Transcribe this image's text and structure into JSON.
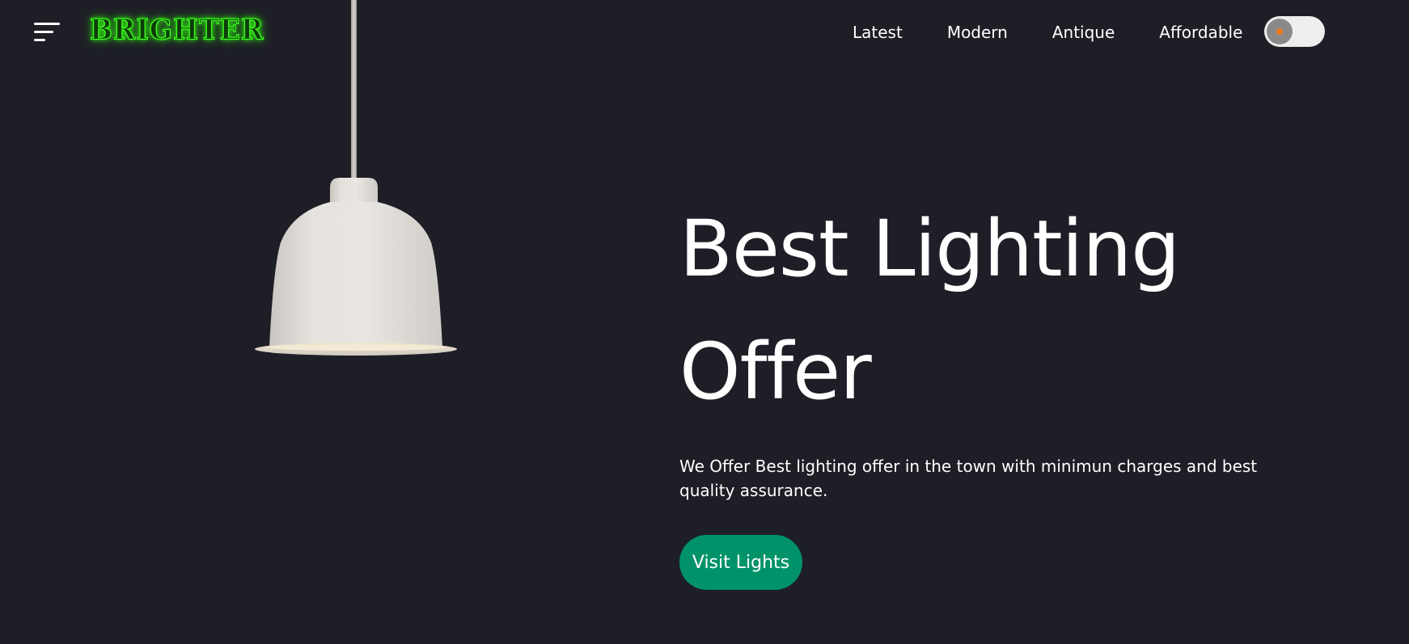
{
  "header": {
    "menu_icon": "hamburger-menu-icon",
    "logo_text": "BRIGHTER",
    "logo_color": "#3bff1c",
    "nav": [
      {
        "label": "Latest"
      },
      {
        "label": "Modern"
      },
      {
        "label": "Antique"
      },
      {
        "label": "Affordable"
      }
    ],
    "theme_toggle": {
      "state": "off",
      "knob_color": "#8a8a8a",
      "dot_color": "#f07a18"
    }
  },
  "hero": {
    "image": "pendant-lamp-image",
    "title_line1": "Best Lighting",
    "title_line2": "Offer",
    "description": "We Offer Best lighting offer in the town with minimun charges and best quality assurance.",
    "button_label": "Visit Lights",
    "button_color": "#00936a"
  },
  "colors": {
    "background": "#1e1f26",
    "text": "#ffffff"
  }
}
